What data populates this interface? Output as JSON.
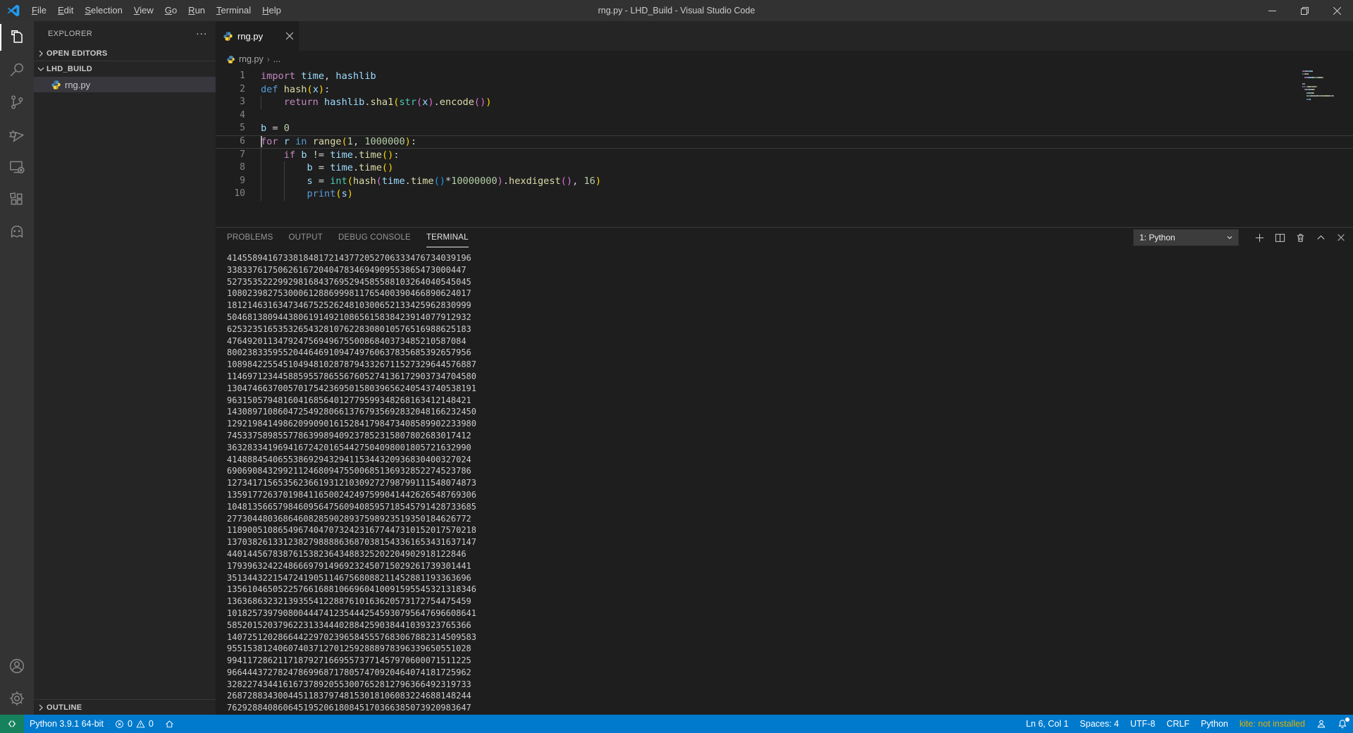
{
  "colors": {
    "accent": "#007acc",
    "statusbar_bg": "#007acc",
    "remote_bg": "#16825d",
    "kite_warning": "#ddb100",
    "titlebar_bg": "#323233",
    "activitybar_bg": "#333333",
    "sidebar_bg": "#252526",
    "editor_bg": "#1e1e1e",
    "selection_bg": "#37373d",
    "panel_tab_active": "#e7e7e7",
    "terminal_text": "#cccccc"
  },
  "titlebar": {
    "title": "rng.py - LHD_Build - Visual Studio Code",
    "menus": [
      "File",
      "Edit",
      "Selection",
      "View",
      "Go",
      "Run",
      "Terminal",
      "Help"
    ]
  },
  "activity_bar": {
    "items": [
      "explorer",
      "search",
      "source-control",
      "run-and-debug",
      "remote-explorer",
      "extensions",
      "kite"
    ],
    "bottom_items": [
      "account",
      "settings"
    ]
  },
  "sidebar": {
    "title": "EXPLORER",
    "actions_glyph": "···",
    "sections": {
      "open_editors": "OPEN EDITORS",
      "folder": "LHD_BUILD",
      "outline": "OUTLINE"
    },
    "file": "rng.py"
  },
  "editor": {
    "tab_label": "rng.py",
    "breadcrumb": [
      "rng.py",
      "..."
    ],
    "code": {
      "lines": [
        {
          "n": "1",
          "guides": [],
          "tokens": [
            [
              "kw",
              "import"
            ],
            [
              "pl",
              " "
            ],
            [
              "var",
              "time"
            ],
            [
              "pl",
              ", "
            ],
            [
              "var",
              "hashlib"
            ]
          ]
        },
        {
          "n": "2",
          "guides": [],
          "tokens": [
            [
              "blue",
              "def"
            ],
            [
              "pl",
              " "
            ],
            [
              "fn",
              "hash"
            ],
            [
              "b1",
              "("
            ],
            [
              "var",
              "x"
            ],
            [
              "b1",
              ")"
            ],
            [
              "pl",
              ":"
            ]
          ]
        },
        {
          "n": "3",
          "guides": [
            0
          ],
          "tokens": [
            [
              "pl",
              "    "
            ],
            [
              "kw",
              "return"
            ],
            [
              "pl",
              " "
            ],
            [
              "var",
              "hashlib"
            ],
            [
              "pl",
              "."
            ],
            [
              "fn",
              "sha1"
            ],
            [
              "b1",
              "("
            ],
            [
              "bi",
              "str"
            ],
            [
              "b2",
              "("
            ],
            [
              "var",
              "x"
            ],
            [
              "b2",
              ")"
            ],
            [
              "pl",
              "."
            ],
            [
              "fn",
              "encode"
            ],
            [
              "b2",
              "()"
            ],
            [
              "b1",
              ")"
            ]
          ]
        },
        {
          "n": "4",
          "guides": [],
          "tokens": []
        },
        {
          "n": "5",
          "guides": [],
          "tokens": [
            [
              "var",
              "b"
            ],
            [
              "pl",
              " = "
            ],
            [
              "num",
              "0"
            ]
          ]
        },
        {
          "n": "6",
          "current": true,
          "cursor": true,
          "guides": [],
          "tokens": [
            [
              "kw",
              "for"
            ],
            [
              "pl",
              " "
            ],
            [
              "var",
              "r"
            ],
            [
              "pl",
              " "
            ],
            [
              "blue",
              "in"
            ],
            [
              "pl",
              " "
            ],
            [
              "fn",
              "range"
            ],
            [
              "b1",
              "("
            ],
            [
              "num",
              "1"
            ],
            [
              "pl",
              ", "
            ],
            [
              "num",
              "1000000"
            ],
            [
              "b1",
              ")"
            ],
            [
              "pl",
              ":"
            ]
          ]
        },
        {
          "n": "7",
          "guides": [
            0
          ],
          "tokens": [
            [
              "pl",
              "    "
            ],
            [
              "kw",
              "if"
            ],
            [
              "pl",
              " "
            ],
            [
              "var",
              "b"
            ],
            [
              "pl",
              " != "
            ],
            [
              "var",
              "time"
            ],
            [
              "pl",
              "."
            ],
            [
              "fn",
              "time"
            ],
            [
              "b1",
              "()"
            ],
            [
              "pl",
              ":"
            ]
          ]
        },
        {
          "n": "8",
          "guides": [
            0,
            4
          ],
          "tokens": [
            [
              "pl",
              "        "
            ],
            [
              "var",
              "b"
            ],
            [
              "pl",
              " = "
            ],
            [
              "var",
              "time"
            ],
            [
              "pl",
              "."
            ],
            [
              "fn",
              "time"
            ],
            [
              "b1",
              "()"
            ]
          ]
        },
        {
          "n": "9",
          "guides": [
            0,
            4
          ],
          "tokens": [
            [
              "pl",
              "        "
            ],
            [
              "var",
              "s"
            ],
            [
              "pl",
              " = "
            ],
            [
              "bi",
              "int"
            ],
            [
              "b1",
              "("
            ],
            [
              "fn",
              "hash"
            ],
            [
              "b2",
              "("
            ],
            [
              "var",
              "time"
            ],
            [
              "pl",
              "."
            ],
            [
              "fn",
              "time"
            ],
            [
              "b3",
              "()"
            ],
            [
              "pl",
              "*"
            ],
            [
              "num",
              "10000000"
            ],
            [
              "b2",
              ")"
            ],
            [
              "pl",
              "."
            ],
            [
              "fn",
              "hexdigest"
            ],
            [
              "b2",
              "()"
            ],
            [
              "pl",
              ", "
            ],
            [
              "num",
              "16"
            ],
            [
              "b1",
              ")"
            ]
          ]
        },
        {
          "n": "10",
          "guides": [
            0,
            4
          ],
          "tokens": [
            [
              "pl",
              "        "
            ],
            [
              "blue",
              "print"
            ],
            [
              "b1",
              "("
            ],
            [
              "var",
              "s"
            ],
            [
              "b1",
              ")"
            ]
          ]
        }
      ]
    }
  },
  "panel": {
    "tabs": [
      "PROBLEMS",
      "OUTPUT",
      "DEBUG CONSOLE",
      "TERMINAL"
    ],
    "active_tab": "TERMINAL",
    "terminal_select": "1: Python",
    "terminal_lines": [
      "414558941673381848172143772052706333476734039196",
      "33833761750626167204047834694909553865473000447",
      "527353522299298168437695294585588103264040545045",
      "108023982753000612886999811765400390466890624017",
      "181214631634734675252624810300652133425962830999",
      "504681380944380619149210865615838423914077912932",
      "625323516535326543281076228308010576516988625183",
      "47649201134792475694967550086840373485210587084",
      "800238335955204464691094749760637835685392657956",
      "1089842255451049481028787943326711527329644576887",
      "1146971234458859557865567605274136172903734704580",
      "1304746637005701754236950158039656240543740538191",
      "963150579481604168564012779599348268163412148421",
      "1430897108604725492806613767935692832048166232450",
      "1292198414986209909016152841798473408589902233980",
      "745337589855778639989409237852315807802683017412",
      "363283341969416724201654427504098001805721632990",
      "414888454065538692943294115344320936830400327024",
      "690690843299211246809475500685136932852274523786",
      "1273417156535623661931210309272798799111548074873",
      "1359177263701984116500242497599041442626548769306",
      "1048135665798460956475609408595718545791428733685",
      "277304480368646082859028937598923519350184626772",
      "1189005108654967404707324231677447310152017570218",
      "1370382613312382798888636870381543361653431637147",
      "44014456783876153823643488325202204902918122846",
      "179396324224866697914969232450715029261739301441",
      "351344322154724190511467568088211452881193363696",
      "1356104650522576616881066960410091595545321318346",
      "136368632321393554122887610163620573172754475459",
      "1018257397908004447412354442545930795647696608641",
      "585201520379622313344402884259038441039323765366",
      "1407251202866442297023965845557683067882314509583",
      "955153812406074037127012592888978396339650551028",
      "994117286211718792716695573771457970600071511225",
      "966444372782478699687178057470920464074181725962",
      "328227434416167378920553007652812796366492319733",
      "268728834300445118379748153018106083224688148244",
      "762928840860645195206180845170366385073920983647"
    ]
  },
  "status_bar": {
    "python_version": "Python 3.9.1 64-bit",
    "errors": "0",
    "warnings": "0",
    "line_col": "Ln 6, Col 1",
    "spaces": "Spaces: 4",
    "encoding": "UTF-8",
    "eol": "CRLF",
    "language": "Python",
    "kite": "kite: not installed"
  }
}
